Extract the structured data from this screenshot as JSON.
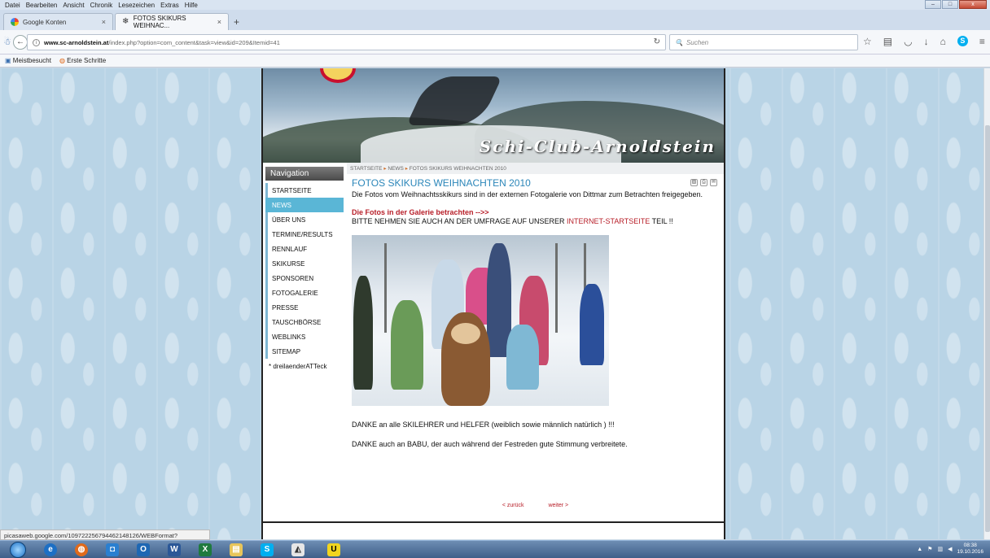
{
  "menu": [
    "Datei",
    "Bearbeiten",
    "Ansicht",
    "Chronik",
    "Lesezeichen",
    "Extras",
    "Hilfe"
  ],
  "tabs": [
    {
      "label": "Google Konten",
      "icon": "google-icon"
    },
    {
      "label": "FOTOS SKIKURS WEIHNAC...",
      "icon": "snowflake-icon"
    }
  ],
  "url": {
    "domain": "www.sc-arnoldstein.at",
    "path": "/index.php?option=com_content&task=view&id=209&Itemid=41"
  },
  "search": {
    "placeholder": "Suchen"
  },
  "bookmarks": [
    "Meistbesucht",
    "Erste Schritte"
  ],
  "site": {
    "title": "Schi-Club-Arnoldstein"
  },
  "navigation": {
    "header": "Navigation",
    "items": [
      {
        "label": "STARTSEITE",
        "active": false
      },
      {
        "label": "NEWS",
        "active": true
      },
      {
        "label": "ÜBER UNS",
        "active": false
      },
      {
        "label": "TERMINE/RESULTS",
        "active": false
      },
      {
        "label": "RENNLAUF",
        "active": false
      },
      {
        "label": "SKIKURSE",
        "active": false
      },
      {
        "label": "SPONSOREN",
        "active": false
      },
      {
        "label": "FOTOGALERIE",
        "active": false
      },
      {
        "label": "PRESSE",
        "active": false
      },
      {
        "label": "TAUSCHBÖRSE",
        "active": false
      },
      {
        "label": "WEBLINKS",
        "active": false
      },
      {
        "label": "SITEMAP",
        "active": false
      },
      {
        "label": "* dreilaenderATTeck",
        "active": false
      }
    ]
  },
  "breadcrumb": [
    "STARTSEITE",
    "NEWS",
    "FOTOS SKIKURS WEIHNACHTEN 2010"
  ],
  "article": {
    "title": "FOTOS SKIKURS WEIHNACHTEN 2010",
    "intro": "Die Fotos vom Weihnachtsskikurs sind in der externen Fotogalerie von Dittmar zum Betrachten freigegeben.",
    "gallery_link": "Die Fotos in der Galerie betrachten -->>",
    "hint_prefix": "BITTE NEHMEN SIE AUCH AN DER UMFRAGE AUF UNSERER ",
    "hint_link": "INTERNET-STARTSEITE",
    "hint_suffix": " TEIL !!",
    "thanks1": "DANKE an alle SKILEHRER und HELFER (weiblich sowie männlich natürlich ) !!!",
    "thanks2": "DANKE auch an BABU, der auch während der Festreden gute Stimmung verbreitete."
  },
  "pager": {
    "prev": "< zurück",
    "next": "weiter >"
  },
  "status_url": "picasaweb.google.com/109722256794462148126/WEBFormat?feat=email#",
  "clock": {
    "time": "08:38",
    "date": "19.10.2016"
  }
}
